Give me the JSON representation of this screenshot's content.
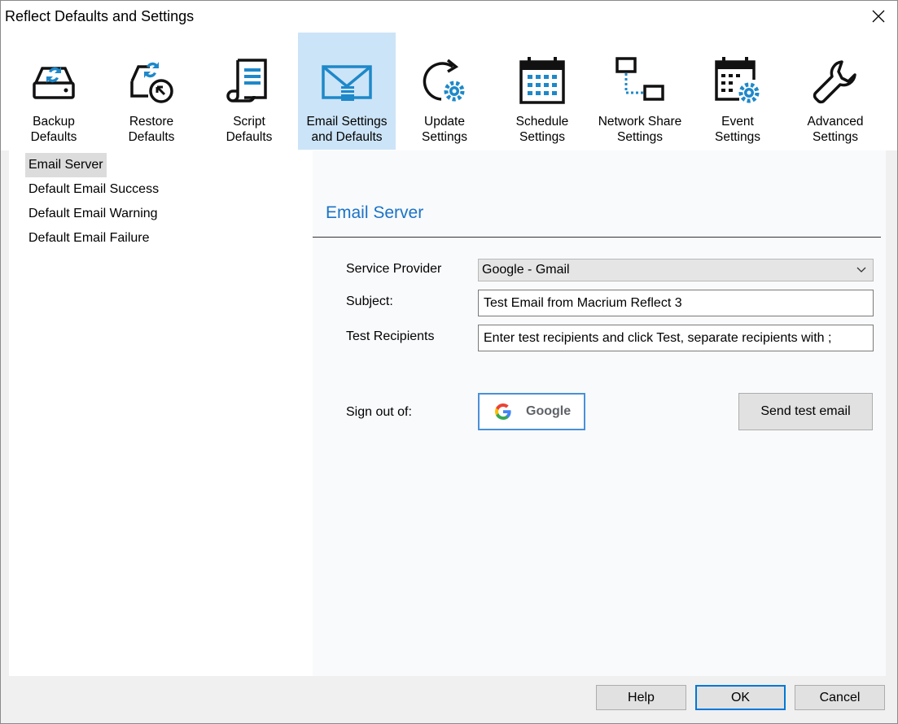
{
  "window": {
    "title": "Reflect Defaults and Settings"
  },
  "toolbar": {
    "items": [
      {
        "label": "Backup\nDefaults",
        "icon": "backup-drive-icon"
      },
      {
        "label": "Restore\nDefaults",
        "icon": "restore-icon"
      },
      {
        "label": "Script\nDefaults",
        "icon": "script-icon"
      },
      {
        "label": "Email Settings\nand Defaults",
        "icon": "email-icon",
        "active": true
      },
      {
        "label": "Update\nSettings",
        "icon": "update-icon"
      },
      {
        "label": "Schedule\nSettings",
        "icon": "calendar-icon"
      },
      {
        "label": "Network Share\nSettings",
        "icon": "network-share-icon"
      },
      {
        "label": "Event\nSettings",
        "icon": "event-settings-icon"
      },
      {
        "label": "Advanced\nSettings",
        "icon": "wrench-icon"
      }
    ]
  },
  "nav": {
    "items": [
      {
        "label": "Email Server",
        "selected": true
      },
      {
        "label": "Default Email Success"
      },
      {
        "label": "Default Email Warning"
      },
      {
        "label": "Default Email Failure"
      }
    ]
  },
  "email_server": {
    "title": "Email Server",
    "service_provider_label": "Service Provider",
    "service_provider_value": "Google - Gmail",
    "subject_label": "Subject:",
    "subject_value": "Test Email from Macrium Reflect 3",
    "recipients_label": "Test Recipients",
    "recipients_placeholder": "Enter test recipients and click Test, separate recipients with ;",
    "sign_out_label": "Sign out of:",
    "google_button_label": "Google",
    "send_test_label": "Send test email"
  },
  "footer": {
    "help_label": "Help",
    "ok_label": "OK",
    "cancel_label": "Cancel"
  },
  "colors": {
    "accent": "#1a73c6",
    "icon_blue": "#1e88c9",
    "active_tab": "#cce4f7"
  }
}
